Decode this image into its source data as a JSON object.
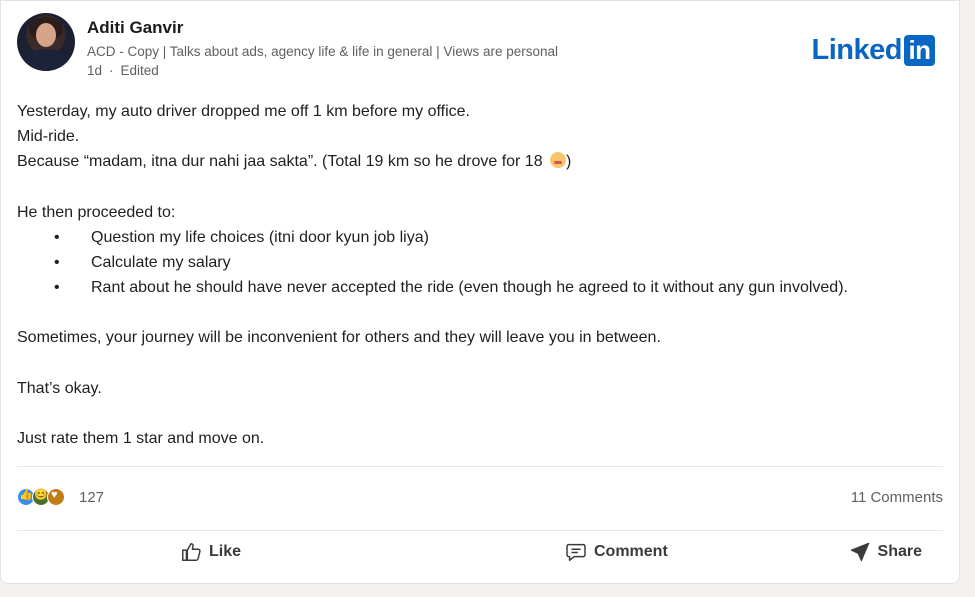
{
  "author": {
    "name": "Aditi Ganvir",
    "headline": "ACD - Copy | Talks about ads, agency life & life in general | Views are personal",
    "time": "1d",
    "edited": "Edited"
  },
  "brand": {
    "logo_text": "Linked",
    "logo_in": "in",
    "color": "#0a66c2"
  },
  "post": {
    "line1": "Yesterday, my auto driver dropped me off 1 km before my office.",
    "line2": "Mid-ride.",
    "line3": "Because “madam, itna dur nahi jaa sakta”. (Total 19 km so he drove for 18 ",
    "line3_end": ")",
    "line4": "He then proceeded to:",
    "bullets": [
      "Question my life choices (itni door kyun job liya)",
      "Calculate my salary",
      "Rant about he should have never accepted the ride (even though he agreed to it without any gun involved)."
    ],
    "line5": "Sometimes, your journey will be inconvenient for others and they will leave you in between.",
    "line6": "That’s okay.",
    "line7": "Just rate them 1 star and move on."
  },
  "stats": {
    "reaction_count": "127",
    "comments": "11 Comments"
  },
  "actions": {
    "like": "Like",
    "comment": "Comment",
    "share": "Share"
  }
}
